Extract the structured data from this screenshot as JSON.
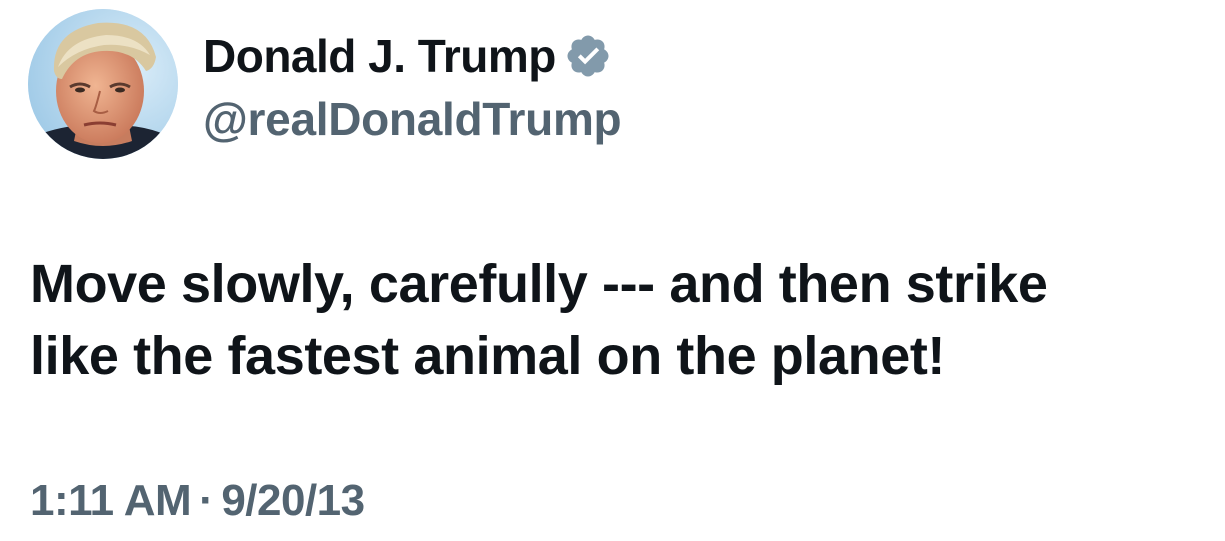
{
  "author": {
    "display_name": "Donald J. Trump",
    "handle": "@realDonaldTrump",
    "verified_icon": "verified-badge-icon",
    "badge_color": "#829aab",
    "avatar_image": "profile-photo"
  },
  "tweet": {
    "lines": [
      "Move slowly, carefully --- and then strike",
      "like the fastest animal on the planet!"
    ]
  },
  "meta": {
    "time": "1:11 AM",
    "separator": "·",
    "date": "9/20/13"
  },
  "colors": {
    "text_primary": "#0f1419",
    "text_secondary": "#536471",
    "background": "#ffffff"
  }
}
